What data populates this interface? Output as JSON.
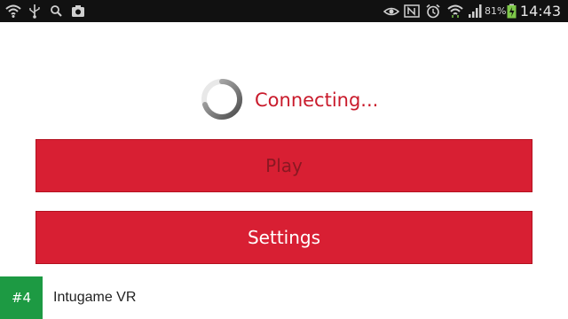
{
  "status_bar": {
    "icons_left": [
      "wifi-icon",
      "usb-icon",
      "search-icon",
      "camera-icon"
    ],
    "icons_right": [
      "eye-icon",
      "nfc-icon",
      "alarm-icon",
      "wifi-signal-icon",
      "cell-signal-icon",
      "battery-icon"
    ],
    "battery": "81%",
    "time": "14:43"
  },
  "main": {
    "status_text": "Connecting...",
    "play_label": "Play",
    "settings_label": "Settings"
  },
  "footer": {
    "rank": "#4",
    "app_name": "Intugame VR"
  },
  "colors": {
    "accent": "#d81f33",
    "status_text": "#c91a2b",
    "badge": "#1d9a43"
  }
}
